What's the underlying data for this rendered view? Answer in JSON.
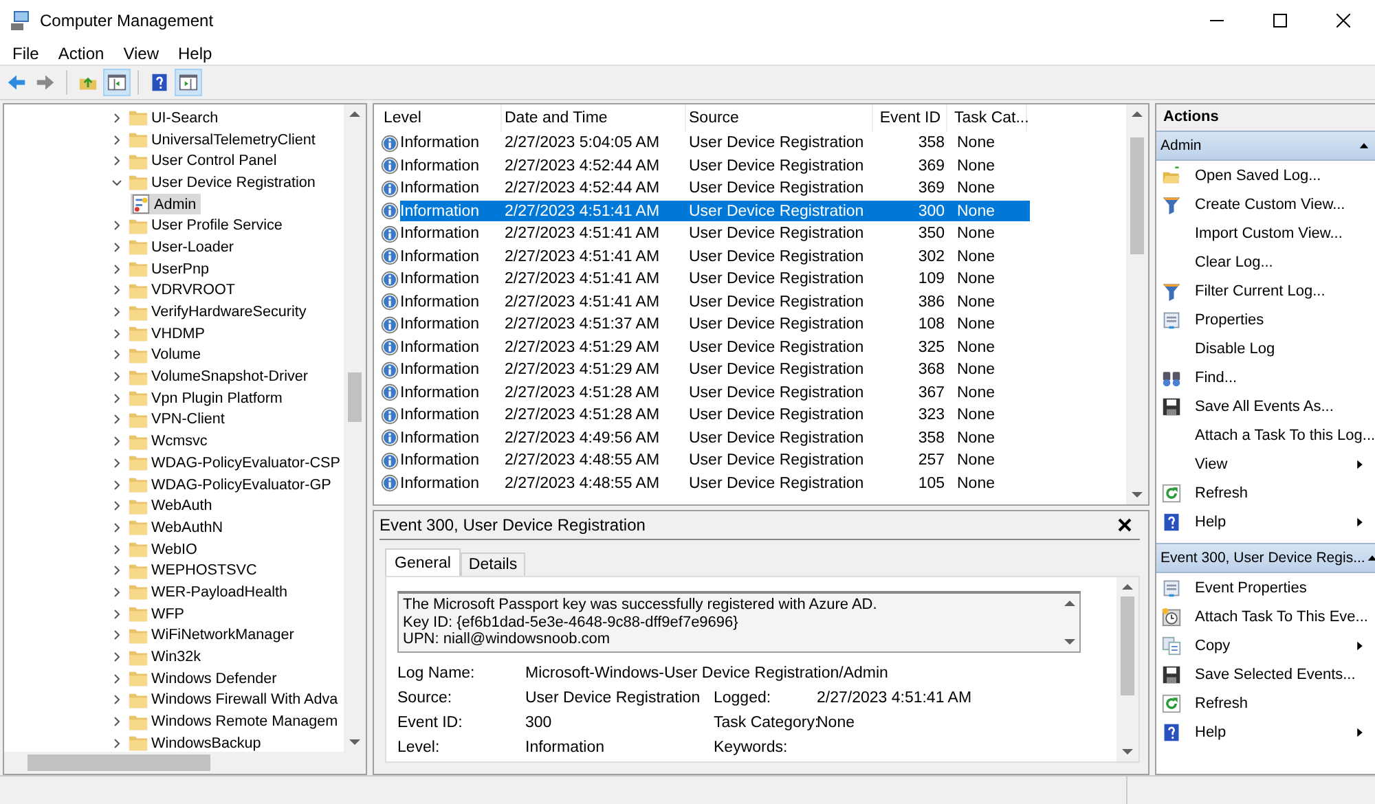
{
  "window": {
    "title": "Computer Management"
  },
  "menu": [
    "File",
    "Action",
    "View",
    "Help"
  ],
  "tree": {
    "items": [
      {
        "label": "UI-Search",
        "expanded": false,
        "selected": false
      },
      {
        "label": "UniversalTelemetryClient",
        "expanded": false,
        "selected": false
      },
      {
        "label": "User Control Panel",
        "expanded": false,
        "selected": false
      },
      {
        "label": "User Device Registration",
        "expanded": true,
        "selected": false,
        "children": [
          {
            "label": "Admin",
            "selected": true
          }
        ]
      },
      {
        "label": "User Profile Service",
        "expanded": false,
        "selected": false
      },
      {
        "label": "User-Loader",
        "expanded": false,
        "selected": false
      },
      {
        "label": "UserPnp",
        "expanded": false,
        "selected": false
      },
      {
        "label": "VDRVROOT",
        "expanded": false,
        "selected": false
      },
      {
        "label": "VerifyHardwareSecurity",
        "expanded": false,
        "selected": false
      },
      {
        "label": "VHDMP",
        "expanded": false,
        "selected": false
      },
      {
        "label": "Volume",
        "expanded": false,
        "selected": false
      },
      {
        "label": "VolumeSnapshot-Driver",
        "expanded": false,
        "selected": false
      },
      {
        "label": "Vpn Plugin Platform",
        "expanded": false,
        "selected": false
      },
      {
        "label": "VPN-Client",
        "expanded": false,
        "selected": false
      },
      {
        "label": "Wcmsvc",
        "expanded": false,
        "selected": false
      },
      {
        "label": "WDAG-PolicyEvaluator-CSP",
        "expanded": false,
        "selected": false
      },
      {
        "label": "WDAG-PolicyEvaluator-GP",
        "expanded": false,
        "selected": false
      },
      {
        "label": "WebAuth",
        "expanded": false,
        "selected": false
      },
      {
        "label": "WebAuthN",
        "expanded": false,
        "selected": false
      },
      {
        "label": "WebIO",
        "expanded": false,
        "selected": false
      },
      {
        "label": "WEPHOSTSVC",
        "expanded": false,
        "selected": false
      },
      {
        "label": "WER-PayloadHealth",
        "expanded": false,
        "selected": false
      },
      {
        "label": "WFP",
        "expanded": false,
        "selected": false
      },
      {
        "label": "WiFiNetworkManager",
        "expanded": false,
        "selected": false
      },
      {
        "label": "Win32k",
        "expanded": false,
        "selected": false
      },
      {
        "label": "Windows Defender",
        "expanded": false,
        "selected": false
      },
      {
        "label": "Windows Firewall With Adva",
        "expanded": false,
        "selected": false
      },
      {
        "label": "Windows Remote Managem",
        "expanded": false,
        "selected": false
      },
      {
        "label": "WindowsBackup",
        "expanded": false,
        "selected": false
      }
    ]
  },
  "events": {
    "columns": [
      "Level",
      "Date and Time",
      "Source",
      "Event ID",
      "Task Cat..."
    ],
    "rows": [
      {
        "level": "Information",
        "date": "2/27/2023 5:04:05 AM",
        "source": "User Device Registration",
        "event_id": "358",
        "task_category": "None",
        "selected": false
      },
      {
        "level": "Information",
        "date": "2/27/2023 4:52:44 AM",
        "source": "User Device Registration",
        "event_id": "369",
        "task_category": "None",
        "selected": false
      },
      {
        "level": "Information",
        "date": "2/27/2023 4:52:44 AM",
        "source": "User Device Registration",
        "event_id": "369",
        "task_category": "None",
        "selected": false
      },
      {
        "level": "Information",
        "date": "2/27/2023 4:51:41 AM",
        "source": "User Device Registration",
        "event_id": "300",
        "task_category": "None",
        "selected": true
      },
      {
        "level": "Information",
        "date": "2/27/2023 4:51:41 AM",
        "source": "User Device Registration",
        "event_id": "350",
        "task_category": "None",
        "selected": false
      },
      {
        "level": "Information",
        "date": "2/27/2023 4:51:41 AM",
        "source": "User Device Registration",
        "event_id": "302",
        "task_category": "None",
        "selected": false
      },
      {
        "level": "Information",
        "date": "2/27/2023 4:51:41 AM",
        "source": "User Device Registration",
        "event_id": "109",
        "task_category": "None",
        "selected": false
      },
      {
        "level": "Information",
        "date": "2/27/2023 4:51:41 AM",
        "source": "User Device Registration",
        "event_id": "386",
        "task_category": "None",
        "selected": false
      },
      {
        "level": "Information",
        "date": "2/27/2023 4:51:37 AM",
        "source": "User Device Registration",
        "event_id": "108",
        "task_category": "None",
        "selected": false
      },
      {
        "level": "Information",
        "date": "2/27/2023 4:51:29 AM",
        "source": "User Device Registration",
        "event_id": "325",
        "task_category": "None",
        "selected": false
      },
      {
        "level": "Information",
        "date": "2/27/2023 4:51:29 AM",
        "source": "User Device Registration",
        "event_id": "368",
        "task_category": "None",
        "selected": false
      },
      {
        "level": "Information",
        "date": "2/27/2023 4:51:28 AM",
        "source": "User Device Registration",
        "event_id": "367",
        "task_category": "None",
        "selected": false
      },
      {
        "level": "Information",
        "date": "2/27/2023 4:51:28 AM",
        "source": "User Device Registration",
        "event_id": "323",
        "task_category": "None",
        "selected": false
      },
      {
        "level": "Information",
        "date": "2/27/2023 4:49:56 AM",
        "source": "User Device Registration",
        "event_id": "358",
        "task_category": "None",
        "selected": false
      },
      {
        "level": "Information",
        "date": "2/27/2023 4:48:55 AM",
        "source": "User Device Registration",
        "event_id": "257",
        "task_category": "None",
        "selected": false
      },
      {
        "level": "Information",
        "date": "2/27/2023 4:48:55 AM",
        "source": "User Device Registration",
        "event_id": "105",
        "task_category": "None",
        "selected": false
      }
    ]
  },
  "detail": {
    "title": "Event 300, User Device Registration",
    "tabs": [
      {
        "label": "General",
        "selected": true
      },
      {
        "label": "Details",
        "selected": false
      }
    ],
    "message": [
      "The Microsoft Passport key was successfully registered with Azure AD.",
      "Key ID: {ef6b1dad-5e3e-4648-9c88-dff9ef7e9696}",
      "UPN: niall@windowsnoob.com"
    ],
    "properties": [
      [
        {
          "label": "Log Name:",
          "value": "Microsoft-Windows-User Device Registration/Admin"
        }
      ],
      [
        {
          "label": "Source:",
          "value": "User Device Registration"
        },
        {
          "label": "Logged:",
          "value": "2/27/2023 4:51:41 AM"
        }
      ],
      [
        {
          "label": "Event ID:",
          "value": "300"
        },
        {
          "label": "Task Category:",
          "value": "None"
        }
      ],
      [
        {
          "label": "Level:",
          "value": "Information"
        },
        {
          "label": "Keywords:"
        }
      ]
    ]
  },
  "actions": {
    "title": "Actions",
    "sections": [
      {
        "title": "Admin",
        "expanded": true,
        "items": [
          {
            "label": "Open Saved Log...",
            "kind": "folder",
            "submenu": false
          },
          {
            "label": "Create Custom View...",
            "kind": "funnel",
            "submenu": false
          },
          {
            "label": "Import Custom View...",
            "kind": "plain",
            "submenu": false
          },
          {
            "label": "Clear Log...",
            "kind": "plain",
            "submenu": false
          },
          {
            "label": "Filter Current Log...",
            "kind": "funnel",
            "submenu": false
          },
          {
            "label": "Properties",
            "kind": "properties",
            "submenu": false
          },
          {
            "label": "Disable Log",
            "kind": "plain",
            "submenu": false
          },
          {
            "label": "Find...",
            "kind": "binoculars",
            "submenu": false
          },
          {
            "label": "Save All Events As...",
            "kind": "floppy",
            "submenu": false
          },
          {
            "label": "Attach a Task To this Log...",
            "kind": "plain",
            "submenu": false
          },
          {
            "label": "View",
            "kind": "plain",
            "submenu": true
          },
          {
            "label": "Refresh",
            "kind": "refresh",
            "submenu": false
          },
          {
            "label": "Help",
            "kind": "help",
            "submenu": true
          }
        ]
      },
      {
        "title": "Event 300, User Device Regis...",
        "expanded": true,
        "items": [
          {
            "label": "Event Properties",
            "kind": "properties",
            "submenu": false
          },
          {
            "label": "Attach Task To This Eve...",
            "kind": "clock",
            "submenu": false
          },
          {
            "label": "Copy",
            "kind": "copy",
            "submenu": true
          },
          {
            "label": "Save Selected Events...",
            "kind": "floppy",
            "submenu": false
          },
          {
            "label": "Refresh",
            "kind": "refresh",
            "submenu": false
          },
          {
            "label": "Help",
            "kind": "help",
            "submenu": true
          }
        ]
      }
    ]
  }
}
